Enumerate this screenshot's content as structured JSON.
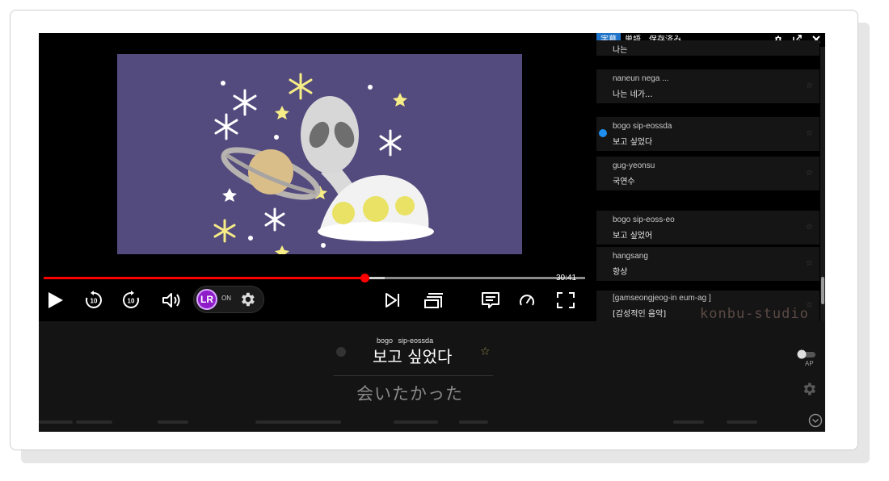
{
  "player": {
    "time_total": "30:41",
    "progress_fraction": 0.593,
    "buffer_fraction": 0.63,
    "lr_toggle_label": "ON",
    "lr_badge_text": "LR"
  },
  "panel": {
    "tabs": [
      {
        "label": "字幕",
        "active": true
      },
      {
        "label": "単語",
        "active": false
      },
      {
        "label": "保存済み",
        "active": false
      }
    ],
    "items": [
      {
        "roman": "",
        "korean": "나는"
      },
      {
        "roman": "naneun nega ...",
        "korean": "나는 네가..."
      },
      {
        "roman": "bogo sip-eossda",
        "korean": "보고 싶었다",
        "current": true
      },
      {
        "roman": "gug-yeonsu",
        "korean": "국연수"
      },
      {
        "roman": "bogo sip-eoss-eo",
        "korean": "보고 싶었어"
      },
      {
        "roman": "hangsang",
        "korean": "항상"
      },
      {
        "roman": "[gamseongjeog-in eum-ag ]",
        "korean": "[감성적인 음악]"
      }
    ],
    "watermark": "konbu-studio"
  },
  "current_subtitle": {
    "roman_1": "bogo",
    "roman_2": "sip-eossda",
    "korean": "보고 싶었다",
    "translation": "会いたかった"
  },
  "autoplay_label": "AP",
  "colors": {
    "accent": "#1f73c8",
    "progress": "#ff0000",
    "video_bg": "#534a7e",
    "lr_badge": "#8e1cc8"
  }
}
